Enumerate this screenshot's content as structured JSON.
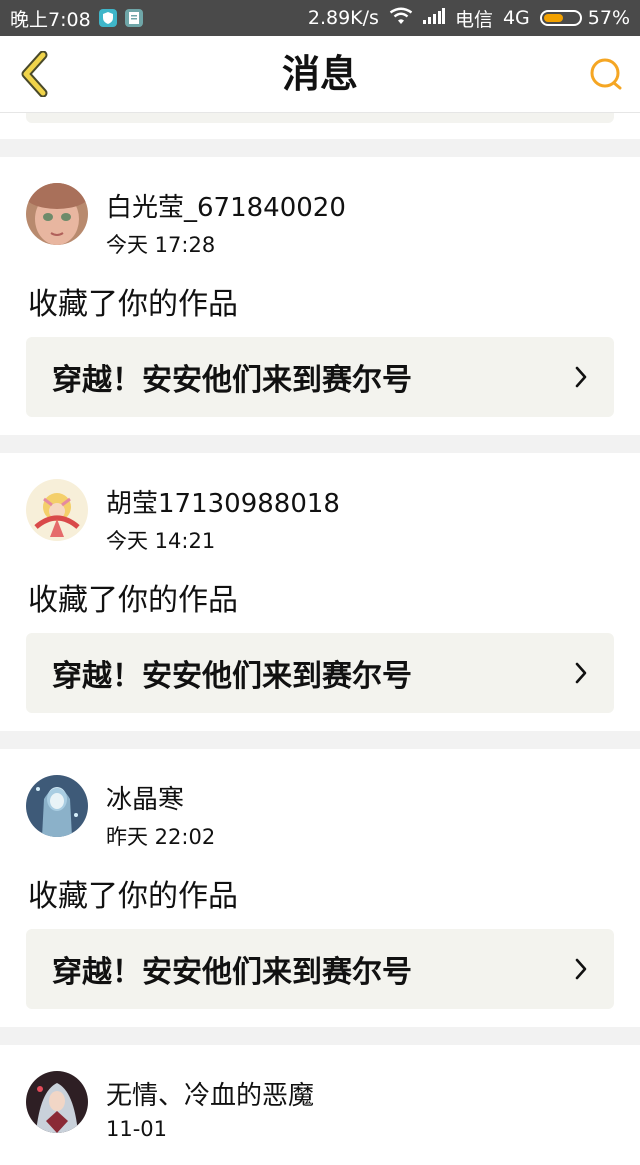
{
  "status_bar": {
    "time": "晚上7:08",
    "network_speed": "2.89K/s",
    "carrier": "电信",
    "network_type": "4G",
    "battery": "57%",
    "battery_level": 0.57
  },
  "header": {
    "title": "消息",
    "back_icon": "back-chevron-icon",
    "search_icon": "search-icon",
    "accent_color": "#f5a623"
  },
  "messages": [
    {
      "username": "白光莹_671840020",
      "time": "今天 17:28",
      "action": "收藏了你的作品",
      "work_title": "穿越！安安他们来到赛尔号"
    },
    {
      "username": "胡莹17130988018",
      "time": "今天 14:21",
      "action": "收藏了你的作品",
      "work_title": "穿越！安安他们来到赛尔号"
    },
    {
      "username": "冰晶寒",
      "time": "昨天 22:02",
      "action": "收藏了你的作品",
      "work_title": "穿越！安安他们来到赛尔号"
    },
    {
      "username": "无情、冷血的恶魔",
      "time": "11-01"
    }
  ]
}
